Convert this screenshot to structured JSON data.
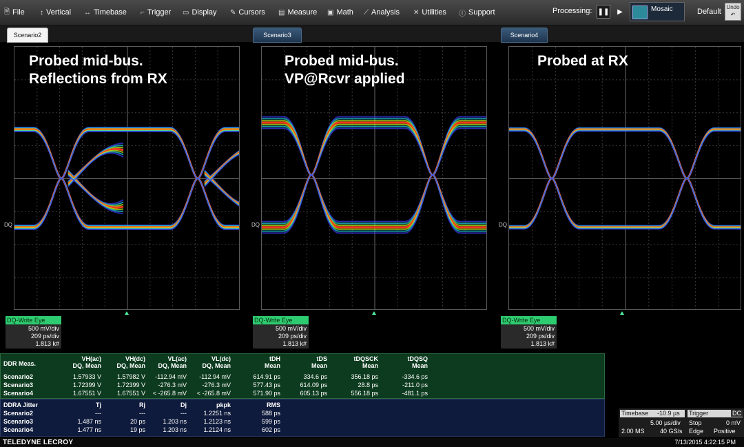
{
  "menu": {
    "file": "File",
    "vertical": "Vertical",
    "timebase": "Timebase",
    "trigger": "Trigger",
    "display": "Display",
    "cursors": "Cursors",
    "measure": "Measure",
    "math": "Math",
    "analysis": "Analysis",
    "utilities": "Utilities",
    "support": "Support"
  },
  "processing": {
    "label": "Processing:",
    "pause": "❚❚",
    "play": "▶"
  },
  "display_mode": "Mosaic",
  "default_label": "Default",
  "undo_label": "Undo",
  "tabs": [
    "Scenario2",
    "Scenario3",
    "Scenario4"
  ],
  "grids": [
    {
      "line1": "Probed mid-bus.",
      "line2": "Reflections from RX"
    },
    {
      "line1": "Probed mid-bus.",
      "line2": "VP@Rcvr applied"
    },
    {
      "line1": "Probed at RX",
      "line2": ""
    }
  ],
  "dq_marker": "DQ",
  "descriptors": [
    {
      "title": "DQ-Write Eye",
      "vdiv": "500 mV/div",
      "tdiv": "209 ps/div",
      "count": "1.813 k#"
    },
    {
      "title": "DQ-Write Eye",
      "vdiv": "500 mV/div",
      "tdiv": "209 ps/div",
      "count": "1.813 k#"
    },
    {
      "title": "DQ-Write Eye",
      "vdiv": "500 mV/div",
      "tdiv": "209 ps/div",
      "count": "1.813 k#"
    }
  ],
  "ddr_meas": {
    "title": "DDR Meas.",
    "columns": [
      {
        "top": "VH(ac)",
        "bottom": "DQ, Mean"
      },
      {
        "top": "VH(dc)",
        "bottom": "DQ, Mean"
      },
      {
        "top": "VL(ac)",
        "bottom": "DQ, Mean"
      },
      {
        "top": "VL(dc)",
        "bottom": "DQ, Mean"
      },
      {
        "top": "tDH",
        "bottom": "Mean"
      },
      {
        "top": "tDS",
        "bottom": "Mean"
      },
      {
        "top": "tDQSCK",
        "bottom": "Mean"
      },
      {
        "top": "tDQSQ",
        "bottom": "Mean"
      }
    ],
    "rows": [
      {
        "name": "Scenario2",
        "values": [
          "1.57933 V",
          "1.57982 V",
          "-112.94 mV",
          "-112.94 mV",
          "614.91 ps",
          "334.6 ps",
          "356.18 ps",
          "-334.6 ps"
        ]
      },
      {
        "name": "Scenario3",
        "values": [
          "1.72399 V",
          "1.72399 V",
          "-276.3 mV",
          "-276.3 mV",
          "577.43 ps",
          "614.09 ps",
          "28.8 ps",
          "-211.0 ps"
        ]
      },
      {
        "name": "Scenario4",
        "values": [
          "1.67551 V",
          "1.67551 V",
          "< -265.8 mV",
          "< -265.8 mV",
          "571.90 ps",
          "605.13 ps",
          "556.18 ps",
          "-481.1 ps"
        ]
      }
    ]
  },
  "ddra_jitter": {
    "title": "DDRA Jitter",
    "columns": [
      "Tj",
      "Rj",
      "Dj",
      "pkpk",
      "RMS"
    ],
    "rows": [
      {
        "name": "Scenario2",
        "values": [
          "---",
          "---",
          "---",
          "1.2251 ns",
          "588 ps"
        ]
      },
      {
        "name": "Scenario3",
        "values": [
          "1.487 ns",
          "20 ps",
          "1.203 ns",
          "1.2123 ns",
          "599 ps"
        ]
      },
      {
        "name": "Scenario4",
        "values": [
          "1.477 ns",
          "19 ps",
          "1.203 ns",
          "1.2124 ns",
          "602 ps"
        ]
      }
    ]
  },
  "timebase": {
    "label": "Timebase",
    "offset": "-10.9 µs",
    "per_div": "5.00 µs/div",
    "points": "2.00 MS",
    "rate": "40 GS/s"
  },
  "trigger": {
    "label": "Trigger",
    "coupling": "DC",
    "mode": "Stop",
    "level": "0 mV",
    "type": "Edge",
    "slope": "Positive"
  },
  "brand": "TELEDYNE LECROY",
  "datetime": "7/13/2015 4:22:15 PM"
}
